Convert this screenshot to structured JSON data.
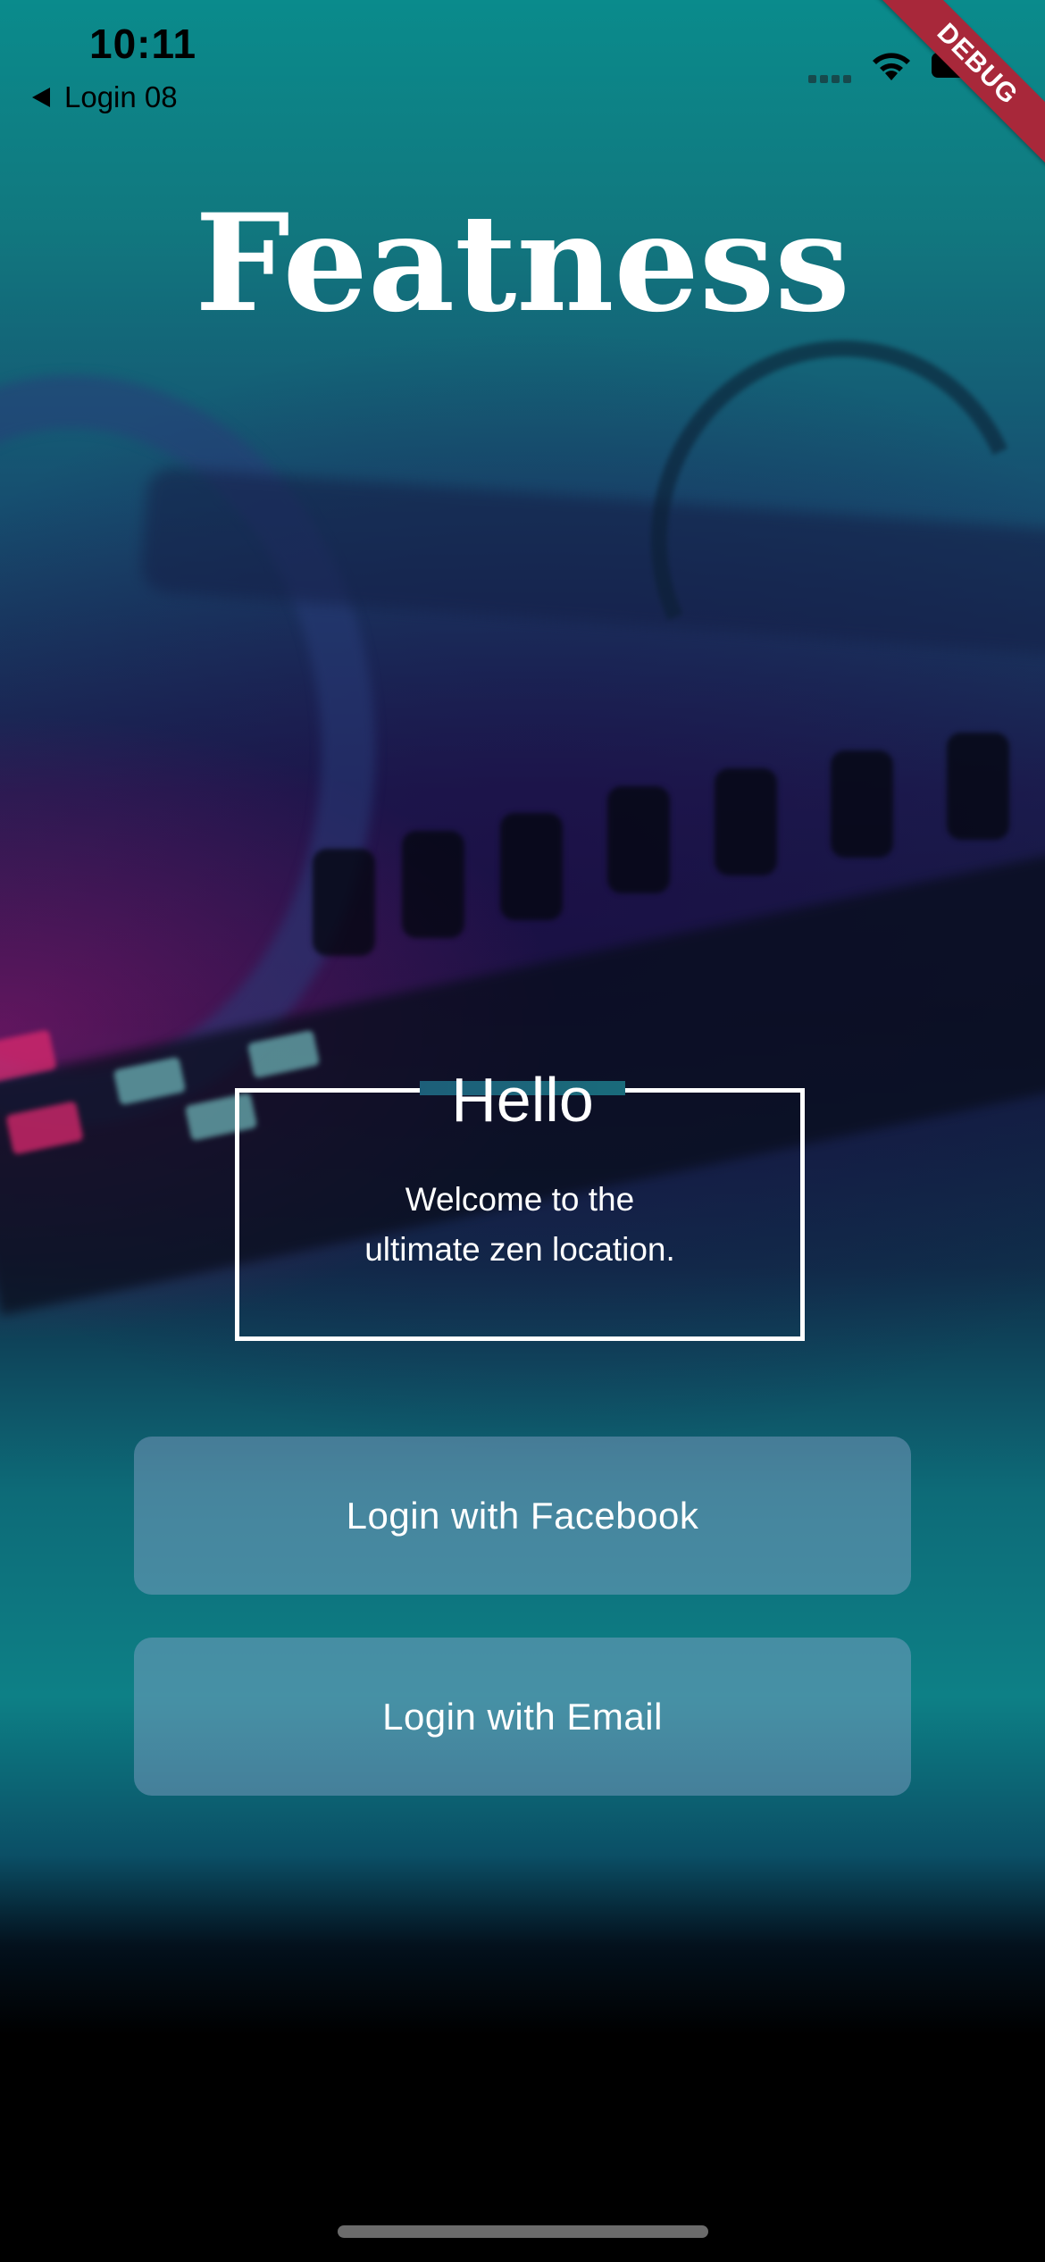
{
  "status_bar": {
    "time": "10:11",
    "back_label": "Login 08",
    "icons": [
      "signal-icon",
      "wifi-icon",
      "battery-icon"
    ]
  },
  "debug_banner": "DEBUG",
  "app": {
    "title": "Featness"
  },
  "greeting": {
    "title": "Hello",
    "line1": "Welcome to the",
    "line2": "ultimate zen location."
  },
  "actions": {
    "facebook_label": "Login with Facebook",
    "email_label": "Login with Email"
  },
  "colors": {
    "primary_teal": "#0a8b8c",
    "button_fill": "rgba(150,170,210,0.42)",
    "text": "#ffffff",
    "debug_ribbon": "#a8283a"
  }
}
